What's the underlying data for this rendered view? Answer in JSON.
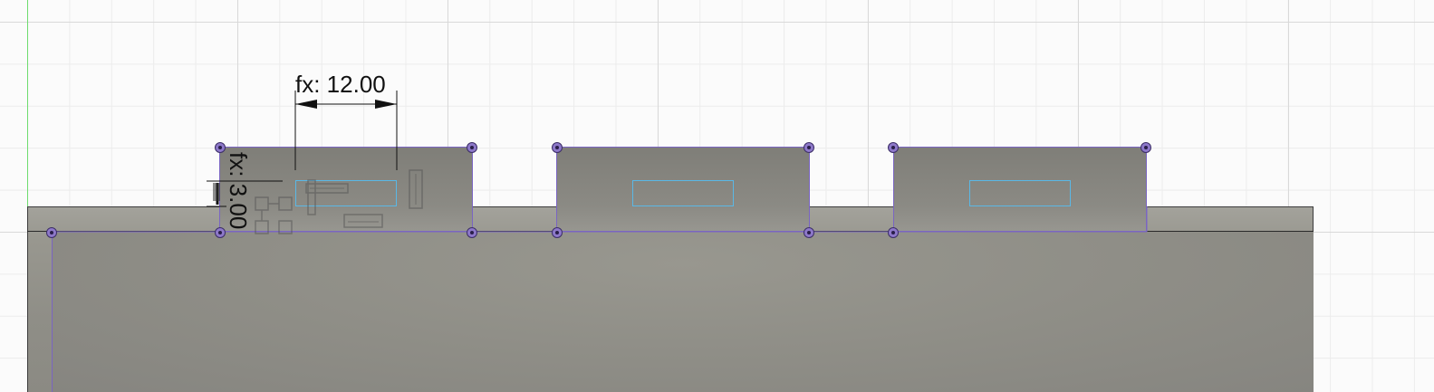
{
  "sketch": {
    "dimension_horizontal": {
      "label": "fx: 12.00"
    },
    "dimension_vertical": {
      "label": "fx: 3.00"
    }
  },
  "colors": {
    "grid_major": "#d9d9d9",
    "grid_minor": "#ececec",
    "sketch_line": "#7a65c2",
    "slot_outline": "#5ab8e6",
    "body_face": "#98978f",
    "y_axis": "#6edc6e"
  },
  "icons": [
    "horizontal-constraint-icon",
    "vertical-constraint-icon",
    "coincident-constraint-icon",
    "fix-constraint-icon",
    "parallel-constraint-icon"
  ]
}
